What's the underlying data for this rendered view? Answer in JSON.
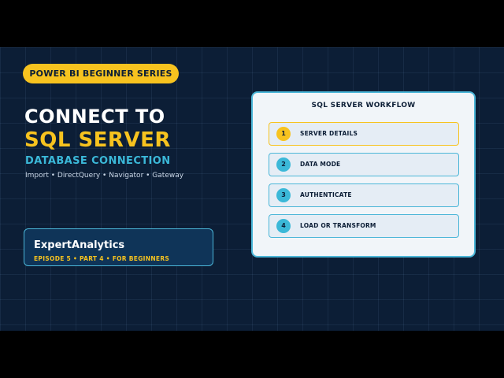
{
  "series": {
    "badge_label": "POWER BI BEGINNER SERIES"
  },
  "title": {
    "line1": "CONNECT TO",
    "line2": "SQL SERVER"
  },
  "subtitle": "DATABASE CONNECTION",
  "tags": "Import • DirectQuery • Navigator • Gateway",
  "brand": {
    "name": "ExpertAnalytics",
    "meta": "EPISODE 5 • PART 4 • FOR BEGINNERS"
  },
  "workflow": {
    "title": "SQL SERVER WORKFLOW",
    "steps": [
      {
        "number": "1",
        "label": "SERVER DETAILS"
      },
      {
        "number": "2",
        "label": "DATA MODE"
      },
      {
        "number": "3",
        "label": "AUTHENTICATE"
      },
      {
        "number": "4",
        "label": "LOAD OR TRANSFORM"
      }
    ],
    "active_step": 1
  },
  "colors": {
    "background": "#0c1e36",
    "accent_yellow": "#f7c31f",
    "accent_cyan": "#3bb8d8",
    "panel": "#f1f5f9"
  }
}
